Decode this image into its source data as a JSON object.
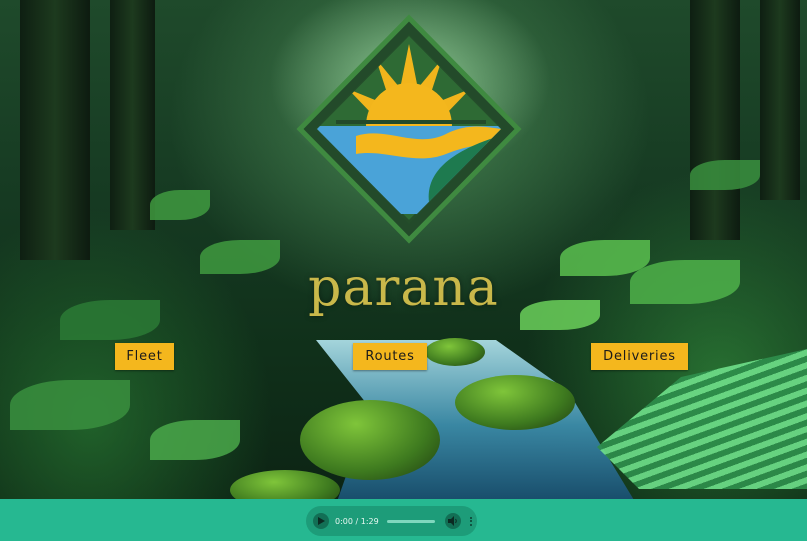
{
  "brand": {
    "name": "parana"
  },
  "nav": {
    "fleet_label": "Fleet",
    "routes_label": "Routes",
    "deliveries_label": "Deliveries"
  },
  "player": {
    "time": "0:00 / 1:29",
    "progress": 0
  },
  "colors": {
    "button": "#f4b71d",
    "footer": "#26b891",
    "brand_text": "#c9b84a"
  },
  "icons": [
    "play-icon",
    "volume-icon",
    "more-options-icon"
  ]
}
